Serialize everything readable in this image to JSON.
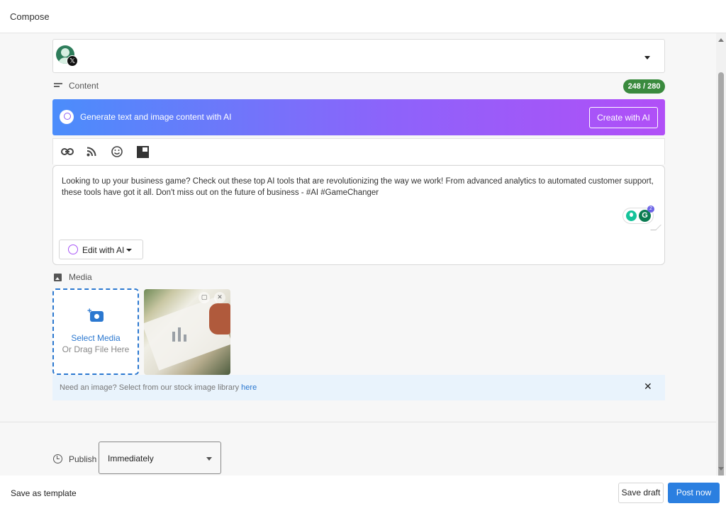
{
  "header": {
    "title": "Compose"
  },
  "account": {
    "network_badge": "𝕏"
  },
  "content": {
    "label": "Content",
    "char_counter": "248 / 280",
    "ai_banner": {
      "text": "Generate text and image content with AI",
      "button": "Create with AI"
    },
    "toolbar": [
      "link-icon",
      "rss-icon",
      "emoji-icon",
      "layout-icon"
    ],
    "post_text": "Looking to up your business game? Check out these top AI tools that are revolutionizing the way we work! From advanced analytics to automated customer support, these tools have got it all. Don't miss out on the future of business - #AI #GameChanger",
    "grammarly_count": "2",
    "edit_ai_label": "Edit with AI"
  },
  "media": {
    "label": "Media",
    "select_label": "Select Media",
    "drag_label": "Or Drag File Here",
    "stock_prefix": "Need an image? Select from our stock image library ",
    "stock_link": "here"
  },
  "publish": {
    "label": "Publish",
    "value": "Immediately"
  },
  "footer": {
    "save_template": "Save as template",
    "save_draft": "Save draft",
    "post_now": "Post now"
  },
  "colors": {
    "accent": "#2b7fe0",
    "counter": "#3a8a3e",
    "gradient_start": "#4b8dfb",
    "gradient_end": "#b14ff7"
  }
}
